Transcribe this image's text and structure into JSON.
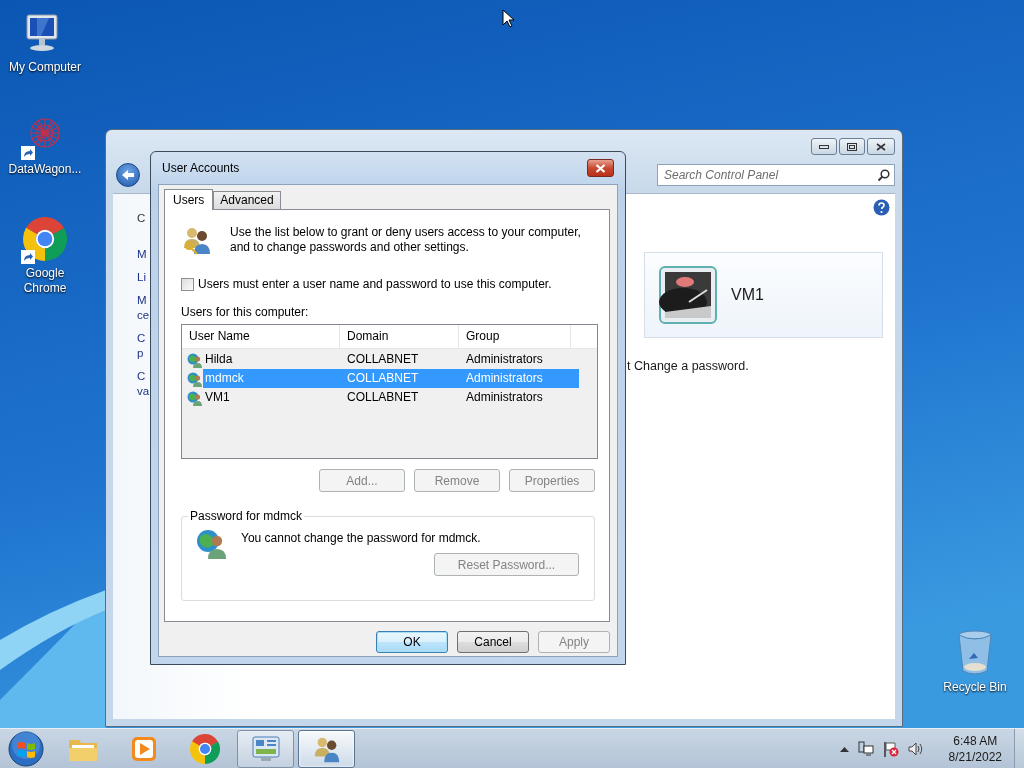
{
  "desktop_icons": [
    {
      "label": "My Computer",
      "kind": "computer",
      "shortcut": false
    },
    {
      "label": "DataWagon...",
      "kind": "network-app",
      "shortcut": true
    },
    {
      "label": "Google Chrome",
      "kind": "chrome",
      "shortcut": true
    },
    {
      "label": "Recycle Bin",
      "kind": "recycle-bin",
      "shortcut": false
    }
  ],
  "control_panel": {
    "search": {
      "placeholder": "Search Control Panel"
    },
    "nav_fragments": [
      {
        "lines": [
          "C"
        ]
      },
      {
        "lines": [
          "M"
        ]
      },
      {
        "lines": [
          "Li"
        ]
      },
      {
        "lines": [
          "M",
          "ce"
        ]
      },
      {
        "lines": [
          "C",
          "p"
        ]
      },
      {
        "lines": [
          "C",
          "va"
        ]
      }
    ],
    "account": {
      "name": "VM1"
    },
    "task_fragment": "t Change a password."
  },
  "dialog": {
    "title": "User Accounts",
    "tabs": [
      {
        "label": "Users",
        "selected": true
      },
      {
        "label": "Advanced",
        "selected": false
      }
    ],
    "intro": "Use the list below to grant or deny users access to your computer, and to change passwords and other settings.",
    "require_password": {
      "label": "Users must enter a user name and password to use this computer.",
      "checked": false
    },
    "list_label": "Users for this computer:",
    "table": {
      "columns": [
        "User Name",
        "Domain",
        "Group"
      ],
      "rows": [
        {
          "cells": [
            "Hilda",
            "COLLABNET",
            "Administrators"
          ],
          "selected": false
        },
        {
          "cells": [
            "mdmck",
            "COLLABNET",
            "Administrators"
          ],
          "selected": true
        },
        {
          "cells": [
            "VM1",
            "COLLABNET",
            "Administrators"
          ],
          "selected": false
        }
      ]
    },
    "buttons": [
      {
        "label": "Add...",
        "disabled": true
      },
      {
        "label": "Remove",
        "disabled": true
      },
      {
        "label": "Properties",
        "disabled": true
      }
    ],
    "password_group": {
      "title": "Password for mdmck",
      "message": "You cannot change the password for mdmck.",
      "button": {
        "label": "Reset Password...",
        "disabled": true
      }
    },
    "footer_buttons": [
      {
        "label": "OK",
        "disabled": false,
        "default": true
      },
      {
        "label": "Cancel",
        "disabled": false,
        "default": false
      },
      {
        "label": "Apply",
        "disabled": true,
        "default": false
      }
    ]
  },
  "taskbar": {
    "items": [
      {
        "kind": "explorer",
        "running": false,
        "selected": false
      },
      {
        "kind": "media-player",
        "running": false,
        "selected": false
      },
      {
        "kind": "chrome",
        "running": false,
        "selected": false
      },
      {
        "kind": "control-panel",
        "running": true,
        "selected": false
      },
      {
        "kind": "user-accounts",
        "running": true,
        "selected": true
      }
    ],
    "clock": {
      "time": "6:48 AM",
      "date": "8/21/2022"
    }
  }
}
